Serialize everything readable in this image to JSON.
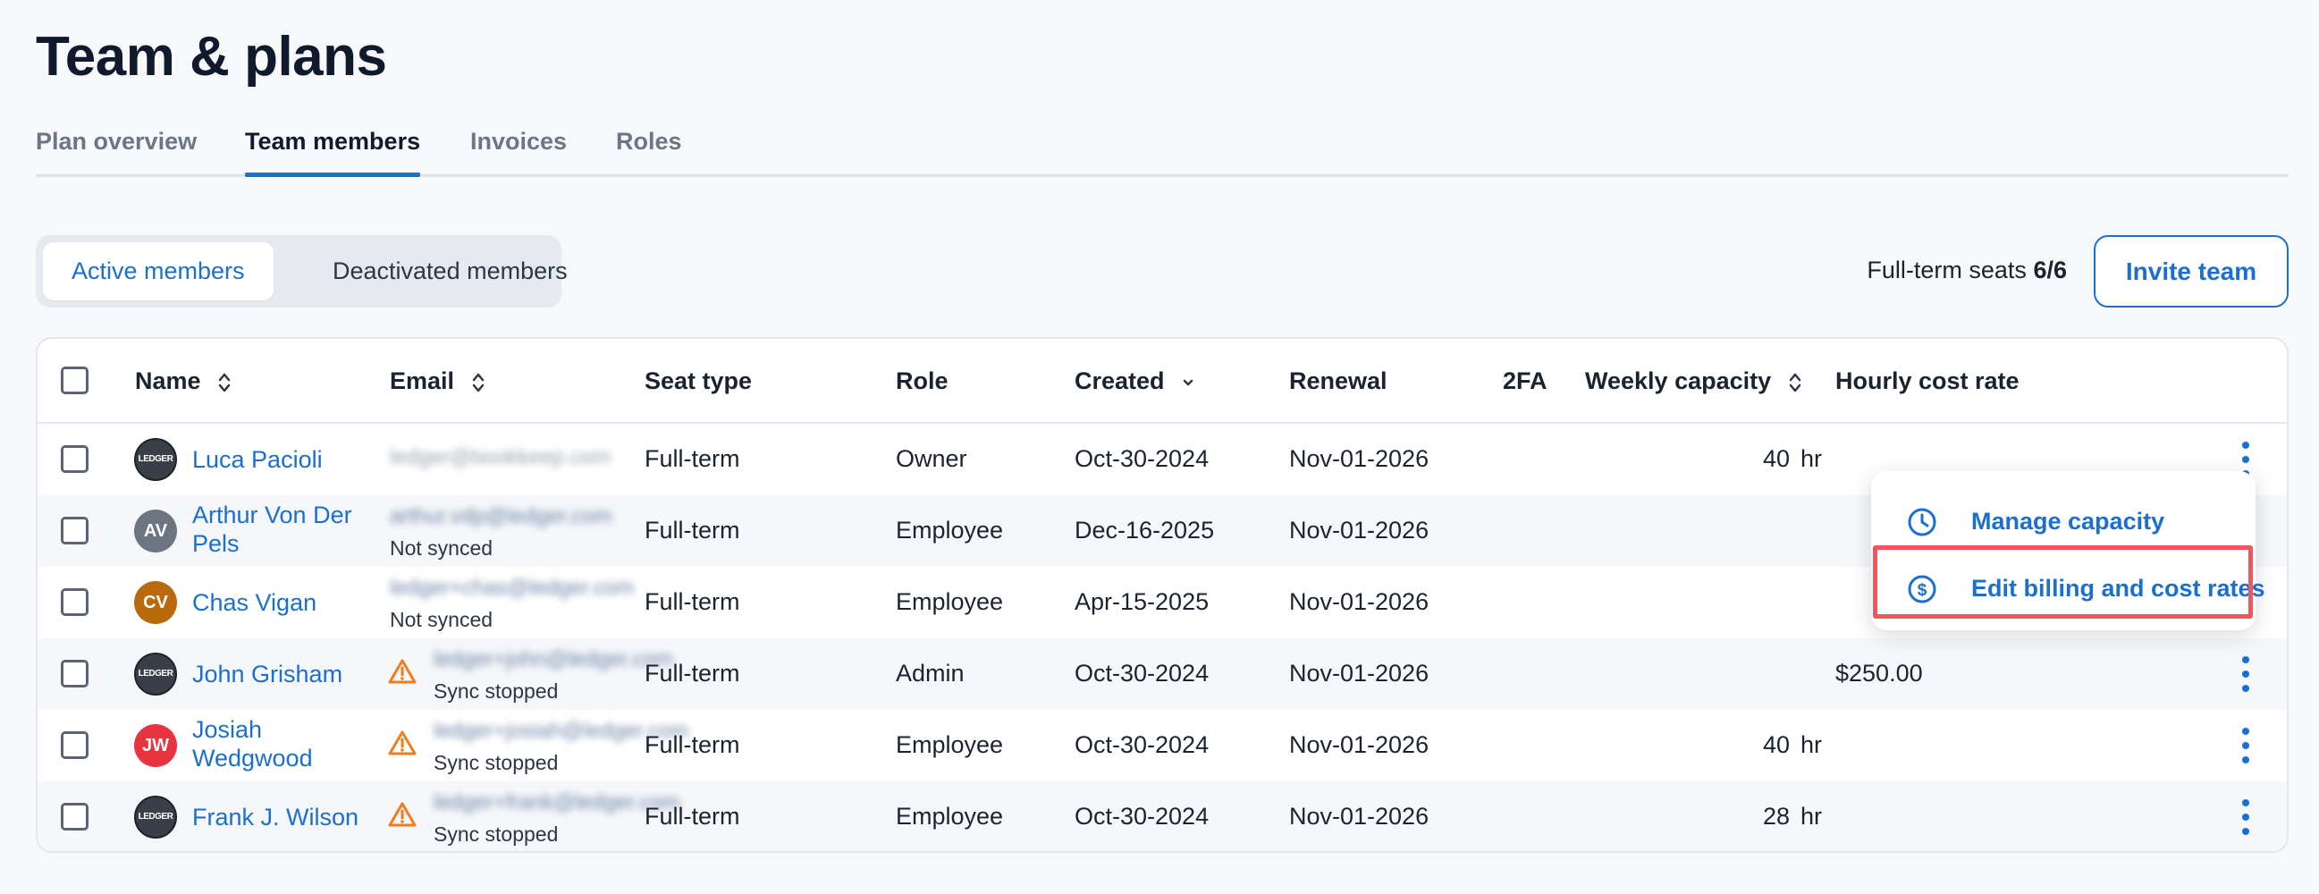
{
  "page": {
    "title": "Team & plans"
  },
  "tabs": [
    {
      "label": "Plan overview",
      "active": false
    },
    {
      "label": "Team members",
      "active": true
    },
    {
      "label": "Invoices",
      "active": false
    },
    {
      "label": "Roles",
      "active": false
    }
  ],
  "member_filter": {
    "active_label": "Active members",
    "deactivated_label": "Deactivated members"
  },
  "seats": {
    "label": "Full-term seats",
    "value": "6/6"
  },
  "invite_label": "Invite team",
  "columns": {
    "name": "Name",
    "email": "Email",
    "seat_type": "Seat type",
    "role": "Role",
    "created": "Created",
    "renewal": "Renewal",
    "twofa": "2FA",
    "weekly_capacity": "Weekly capacity",
    "hourly_cost_rate": "Hourly cost rate"
  },
  "rows": [
    {
      "name": "Luca Pacioli",
      "avatar": "logo",
      "initials": "",
      "email": "ledger@bookkeep.com",
      "sync_status": "",
      "seat_type": "Full-term",
      "role": "Owner",
      "created": "Oct-30-2024",
      "renewal": "Nov-01-2026",
      "capacity": "40",
      "capacity_unit": "hr",
      "rate": ""
    },
    {
      "name": "Arthur Von Der Pels",
      "avatar": "initials",
      "initials": "AV",
      "email": "arthur.vdp@ledger.com",
      "sync_status": "Not synced",
      "seat_type": "Full-term",
      "role": "Employee",
      "created": "Dec-16-2025",
      "renewal": "Nov-01-2026",
      "capacity": "",
      "capacity_unit": "",
      "rate": ""
    },
    {
      "name": "Chas Vigan",
      "avatar": "initials",
      "initials": "CV",
      "email": "ledger+chas@ledger.com",
      "sync_status": "Not synced",
      "seat_type": "Full-term",
      "role": "Employee",
      "created": "Apr-15-2025",
      "renewal": "Nov-01-2026",
      "capacity": "",
      "capacity_unit": "",
      "rate": ""
    },
    {
      "name": "John Grisham",
      "avatar": "logo",
      "initials": "",
      "email": "ledger+john@ledger.com",
      "sync_status": "Sync stopped",
      "seat_type": "Full-term",
      "role": "Admin",
      "created": "Oct-30-2024",
      "renewal": "Nov-01-2026",
      "capacity": "",
      "capacity_unit": "",
      "rate": "$250.00"
    },
    {
      "name": "Josiah Wedgwood",
      "avatar": "initials",
      "initials": "JW",
      "email": "ledger+josiah@ledger.com",
      "sync_status": "Sync stopped",
      "seat_type": "Full-term",
      "role": "Employee",
      "created": "Oct-30-2024",
      "renewal": "Nov-01-2026",
      "capacity": "40",
      "capacity_unit": "hr",
      "rate": ""
    },
    {
      "name": "Frank J. Wilson",
      "avatar": "logo",
      "initials": "",
      "email": "ledger+frank@ledger.com",
      "sync_status": "Sync stopped",
      "seat_type": "Full-term",
      "role": "Employee",
      "created": "Oct-30-2024",
      "renewal": "Nov-01-2026",
      "capacity": "28",
      "capacity_unit": "hr",
      "rate": ""
    }
  ],
  "avatar_colors": {
    "AV": "#6c7482",
    "CV": "#b86a0c",
    "JW": "#e8343f"
  },
  "logo_text": "LEDGER",
  "row_menu": {
    "manage_capacity": "Manage capacity",
    "edit_billing": "Edit billing and cost rates"
  },
  "colors": {
    "accent": "#1b6fd1",
    "warning": "#f07c1e",
    "highlight": "#f0565b"
  }
}
